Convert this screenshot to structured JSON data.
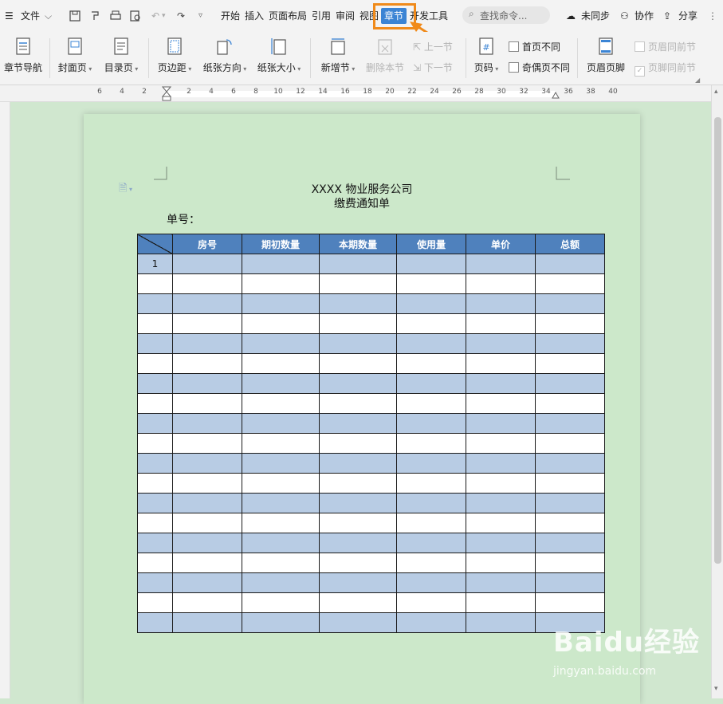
{
  "menubar": {
    "file_label": "文件",
    "tabs": [
      "开始",
      "插入",
      "页面布局",
      "引用",
      "审阅",
      "视图",
      "章节",
      "开发工具"
    ],
    "active_tab": "章节",
    "search_placeholder": "查找命令...",
    "sync_label": "未同步",
    "collab_label": "协作",
    "share_label": "分享"
  },
  "ribbon": {
    "buttons": {
      "chapter_nav": "章节导航",
      "cover": "封面页",
      "toc": "目录页",
      "margins": "页边距",
      "orientation": "纸张方向",
      "size": "纸张大小",
      "new_section": "新增节",
      "delete_section": "删除本节",
      "prev_section": "上一节",
      "next_section": "下一节",
      "page_number": "页码",
      "header_footer": "页眉页脚"
    },
    "checkboxes": {
      "first_page_diff": "首页不同",
      "odd_even_diff": "奇偶页不同",
      "header_same_prev": "页眉同前节",
      "footer_same_prev": "页脚同前节"
    }
  },
  "ruler": {
    "ticks": [
      "6",
      "4",
      "2",
      "2",
      "4",
      "6",
      "8",
      "10",
      "12",
      "14",
      "16",
      "18",
      "20",
      "22",
      "24",
      "26",
      "28",
      "30",
      "32",
      "34",
      "36",
      "38",
      "40"
    ]
  },
  "document": {
    "title": "XXXX 物业服务公司",
    "subtitle": "缴费通知单",
    "bill_no_label": "单号：",
    "table": {
      "headers": [
        "房号",
        "期初数量",
        "本期数量",
        "使用量",
        "单价",
        "总额"
      ],
      "first_row_index": "1",
      "row_count": 19
    }
  },
  "watermark": {
    "brand": "Baidu经验",
    "url": "jingyan.baidu.com"
  },
  "colors": {
    "page_background": "#cce8ca",
    "table_header": "#4f81bd",
    "table_band": "#b8cce4",
    "active_tab": "#3b84d4",
    "highlight": "#f08a1a"
  }
}
